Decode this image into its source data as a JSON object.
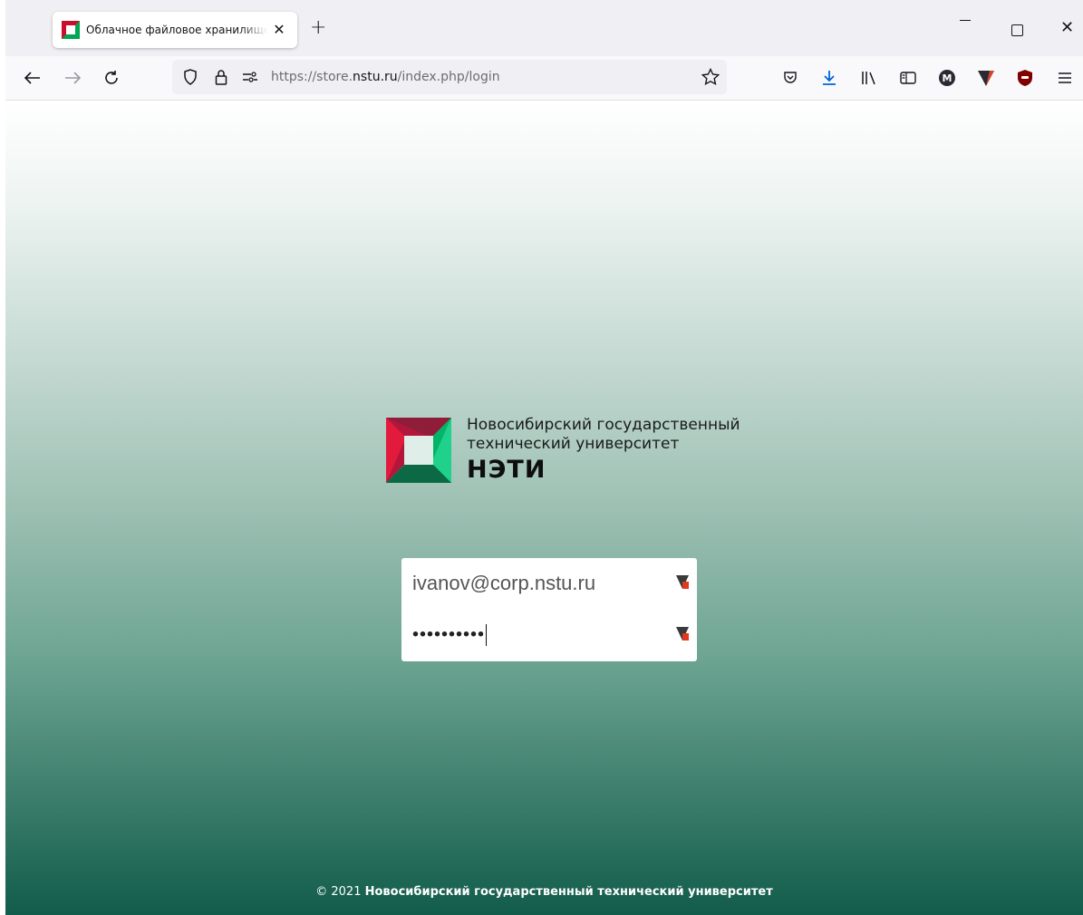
{
  "browser": {
    "tab": {
      "title": "Облачное файловое хранилище",
      "close_glyph": "✕"
    },
    "new_tab_glyph": "+",
    "window_controls": {
      "close_glyph": "✕"
    },
    "url": {
      "prefix": "https://store.",
      "domain": "nstu.ru",
      "path": "/index.php/login"
    },
    "toolbar_icons": [
      "back-icon",
      "forward-icon",
      "reload-icon",
      "shield-icon",
      "lock-icon",
      "permissions-icon",
      "star-icon",
      "pocket-icon",
      "download-icon",
      "library-icon",
      "sidebar-icon",
      "extension-m-icon",
      "extension-v-icon",
      "ublock-icon",
      "menu-icon"
    ],
    "accent_download": "#0061e0"
  },
  "page": {
    "logo": {
      "line1": "Новосибирский государственный",
      "line2": "технический университет",
      "abbr": "НЭТИ"
    },
    "login": {
      "username_value": "ivanov@corp.nstu.ru",
      "password_mask": "••••••••••"
    },
    "footer": {
      "copyright": "© 2021",
      "org": "Новосибирский государственный технический университет"
    }
  }
}
